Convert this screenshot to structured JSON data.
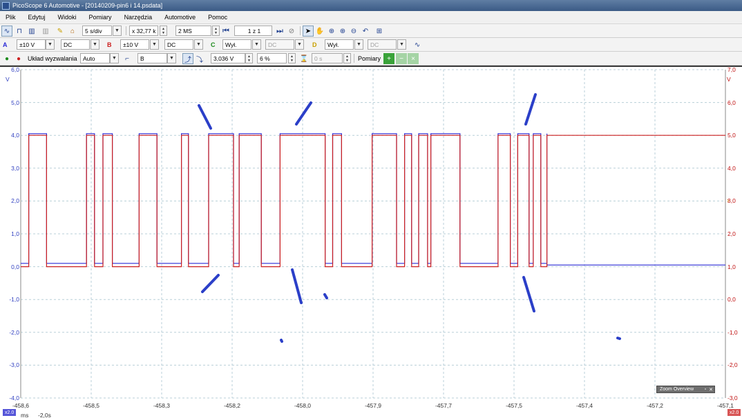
{
  "window": {
    "title": "PicoScope 6 Automotive - [20140209-pin6 i 14.psdata]"
  },
  "menu": [
    "Plik",
    "Edytuj",
    "Widoki",
    "Pomiary",
    "Narzędzia",
    "Automotive",
    "Pomoc"
  ],
  "toolbar1": {
    "timebase": "5 s/div",
    "zoom": "x 32,77 k",
    "samples": "2 MS",
    "buffer": "1 z 1"
  },
  "toolbar2": {
    "channel_a": {
      "label": "A",
      "range": "±10 V",
      "coupling": "DC"
    },
    "channel_b": {
      "label": "B",
      "range": "±10 V",
      "coupling": "DC"
    },
    "channel_c": {
      "label": "C",
      "range": "Wył.",
      "coupling": "DC"
    },
    "channel_d": {
      "label": "D",
      "range": "Wył.",
      "coupling": "DC"
    }
  },
  "toolbar3": {
    "trigger_label": "Układ wyzwalania",
    "trigger_mode": "Auto",
    "trigger_source": "B",
    "trigger_level": "3,036 V",
    "pre_trigger": "6 %",
    "delay": "0 s",
    "measurements_label": "Pomiary"
  },
  "plot": {
    "left_axis_unit": "V",
    "right_axis_unit": "V",
    "left_ticks": [
      "6,0",
      "5,0",
      "4,0",
      "3,0",
      "2,0",
      "1,0",
      "0,0",
      "-1,0",
      "-2,0",
      "-3,0",
      "-4,0"
    ],
    "right_ticks": [
      "7,0",
      "6,0",
      "5,0",
      "4,0",
      "3,0",
      "2,0",
      "1,0",
      "0,0",
      "-1,0",
      "-2,0",
      "-3,0"
    ],
    "x_ticks": [
      "-458,6",
      "-458,5",
      "-458,3",
      "-458,2",
      "-458,0",
      "-457,9",
      "-457,7",
      "-457,5",
      "-457,4",
      "-457,2",
      "-457,1"
    ],
    "x_unit": "ms",
    "x_offset": "-2,0s",
    "left_badge": "x2.0",
    "right_badge": "x2.0",
    "zoom_overview_title": "Zoom Overview",
    "colors": {
      "channel_a": "#2b2bd6",
      "channel_b": "#cc1f1f",
      "grid": "#b8cfd8",
      "annotation": "#2b3fc8"
    }
  },
  "chart_data": {
    "type": "line",
    "xlabel": "ms",
    "ylabel": "V",
    "xlim": [
      -458.6,
      -457.1
    ],
    "ylim_left": [
      -4.0,
      6.0
    ],
    "ylim_right": [
      -3.0,
      7.0
    ],
    "series": [
      {
        "name": "A",
        "color": "#2b2bd6",
        "high": 4.05,
        "low": 0.1,
        "transitions_ms": [
          -458.583,
          -458.545,
          -458.46,
          -458.443,
          -458.425,
          -458.405,
          -458.348,
          -458.31,
          -458.258,
          -458.243,
          -458.2,
          -458.147,
          -458.135,
          -458.088,
          -458.048,
          -457.952,
          -457.936,
          -457.917,
          -457.852,
          -457.8,
          -457.783,
          -457.768,
          -457.753,
          -457.734,
          -457.727,
          -457.665,
          -457.584,
          -457.558,
          -457.542,
          -457.518,
          -457.509,
          -457.493,
          -457.48
        ],
        "end_level": 0.05
      },
      {
        "name": "B",
        "color": "#cc1f1f",
        "high": 5.0,
        "low": 1.0,
        "transitions_ms": [
          -458.583,
          -458.545,
          -458.46,
          -458.443,
          -458.425,
          -458.405,
          -458.348,
          -458.31,
          -458.258,
          -458.243,
          -458.2,
          -458.147,
          -458.135,
          -458.088,
          -458.048,
          -457.952,
          -457.936,
          -457.917,
          -457.852,
          -457.8,
          -457.783,
          -457.768,
          -457.753,
          -457.734,
          -457.727,
          -457.665,
          -457.584,
          -457.558,
          -457.542,
          -457.518,
          -457.509,
          -457.493,
          -457.48
        ],
        "end_level": 5.0
      }
    ]
  }
}
